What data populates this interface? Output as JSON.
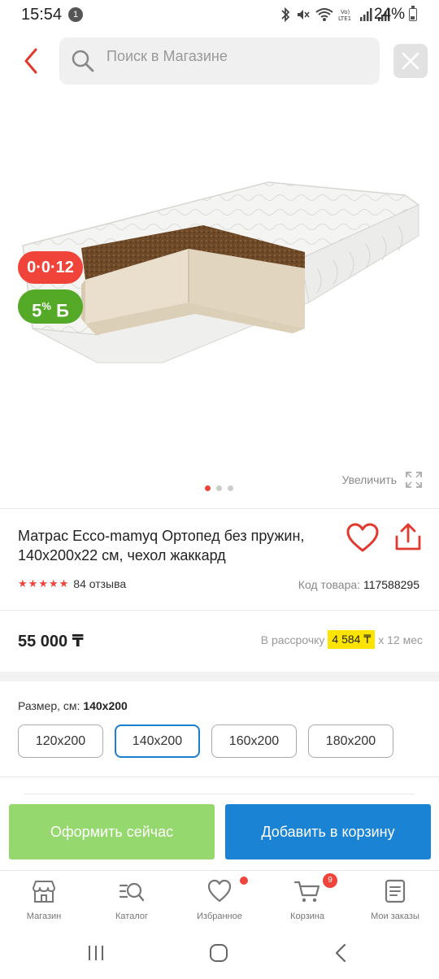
{
  "status_bar": {
    "time": "15:54",
    "notification_count": "1",
    "battery": "24%",
    "lte_label": "Vo)\nLTE1"
  },
  "search": {
    "placeholder": "Поиск в Магазине"
  },
  "product": {
    "badge_installment": "0·0·12",
    "badge_bonus_value": "5",
    "badge_bonus_unit": "%",
    "badge_bonus_symbol": "Б",
    "zoom_label": "Увеличить",
    "carousel_total": 3,
    "carousel_active_index": 0,
    "title": "Матрас Ecco-mamyq Ортопед без пружин, 140х200х22 см, чехол жаккард",
    "rating_stars": 5,
    "reviews": "84 отзыва",
    "code_label": "Код товара:",
    "code_value": "117588295",
    "price": "55 000 ₸",
    "installment_prefix": "В рассрочку",
    "installment_amount": "4 584 ₸",
    "installment_suffix": "х 12 мес"
  },
  "size": {
    "label": "Размер, см:",
    "selected": "140х200",
    "options": [
      "120х200",
      "140х200",
      "160х200",
      "180х200"
    ]
  },
  "actions": {
    "buy_now": "Оформить сейчас",
    "add_to_cart": "Добавить в корзину",
    "buy_now_color": "#95d86d",
    "add_to_cart_color": "#1a83d4"
  },
  "bottom_nav": {
    "items": [
      {
        "label": "Магазин",
        "icon": "store-icon"
      },
      {
        "label": "Каталог",
        "icon": "catalog-search-icon"
      },
      {
        "label": "Избранное",
        "icon": "heart-icon"
      },
      {
        "label": "Корзина",
        "icon": "cart-icon"
      },
      {
        "label": "Мои заказы",
        "icon": "orders-icon"
      }
    ],
    "cart_count": "9"
  },
  "colors": {
    "accent_red": "#f0443a",
    "bonus_green": "#54aa27",
    "highlight_yellow": "#fde300",
    "selected_blue": "#1b7fd0"
  }
}
